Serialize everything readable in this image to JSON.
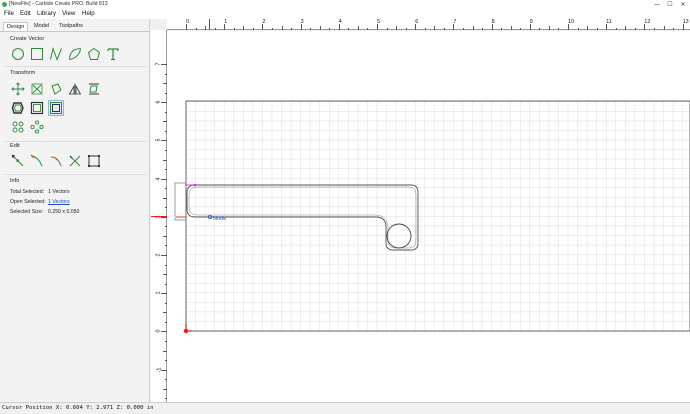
{
  "window": {
    "title": "[NewFile] - Carbide Create PRO, Build 813",
    "minimize_glyph": "—",
    "maximize_glyph": "☐",
    "close_glyph": "✕"
  },
  "menu": [
    "File",
    "Edit",
    "Library",
    "View",
    "Help"
  ],
  "tabs": [
    "Design",
    "Model",
    "Toolpaths"
  ],
  "sections": {
    "create_vector": "Create Vector",
    "transform": "Transform",
    "edit": "Edit",
    "info": "Info"
  },
  "create_vector_icons": [
    "circle-icon",
    "rectangle-icon",
    "polyline-icon",
    "curve-icon",
    "polygon-icon",
    "text-icon"
  ],
  "transform_icons_row1": [
    "move-icon",
    "scale-icon",
    "rotate-icon",
    "mirror-icon",
    "align-icon"
  ],
  "transform_icons_row2": [
    "offset-icon",
    "boolean-union-icon",
    "fit-to-material-icon"
  ],
  "transform_icons_row3": [
    "array-icon",
    "circular-array-icon"
  ],
  "edit_icons": [
    "node-edit-icon",
    "trim-icon",
    "join-icon",
    "cut-icon",
    "bounding-box-icon"
  ],
  "info": {
    "total_selected_label": "Total Selected:",
    "total_selected_value": "1 Vectors",
    "open_selected_label": "Open Selected:",
    "open_selected_value": "1 Vectors",
    "selected_size_label": "Selected Size:",
    "selected_size_value": "0.250 x 0.050"
  },
  "ruler": {
    "x_labels": [
      "0",
      "1",
      "2",
      "3",
      "4",
      "5",
      "6",
      "7",
      "8",
      "9",
      "10",
      "11",
      "12",
      "13"
    ],
    "y_labels": [
      "7",
      "6",
      "5",
      "4",
      "3",
      "2",
      "1",
      "0",
      "-1"
    ]
  },
  "canvas": {
    "node_label": "Node",
    "material_units": "in",
    "grid_color": "#dcdcdc",
    "border_color": "#444444",
    "accent_magenta": "#cc33cc",
    "accent_red": "#e02020",
    "icon_green": "#2e8b3a"
  },
  "status": {
    "text": "Cursor Position X: 0.604 Y: 2.971 Z: 0.000 in"
  }
}
